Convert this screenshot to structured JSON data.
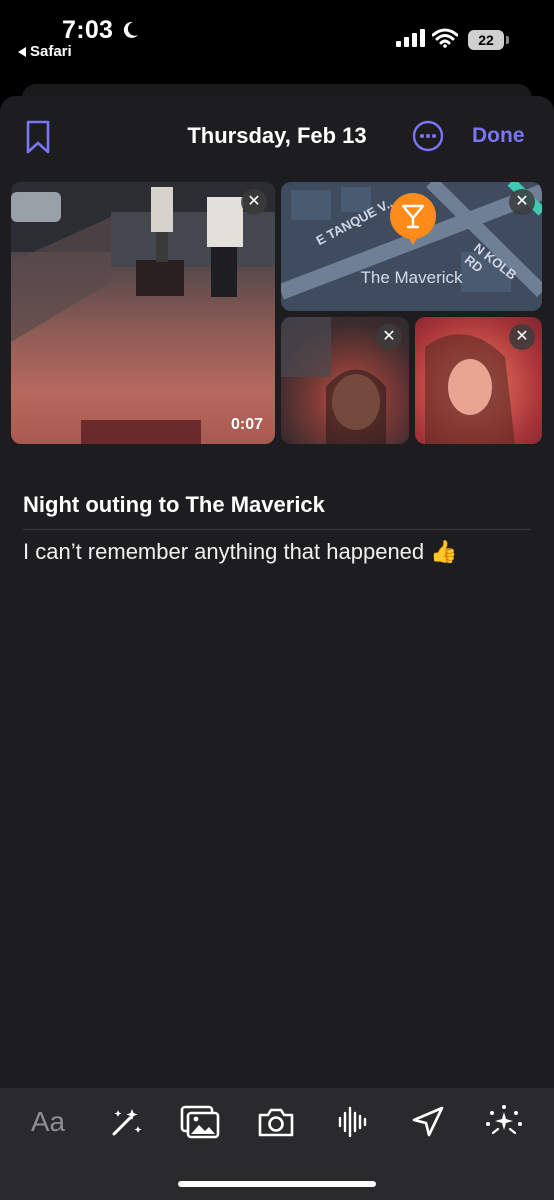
{
  "status_bar": {
    "time": "7:03",
    "back_label": "Safari",
    "battery": "22"
  },
  "header": {
    "title": "Thursday, Feb 13",
    "done_label": "Done"
  },
  "media": {
    "video_duration": "0:07",
    "map_place": "The Maverick",
    "map_street_1": "E TANQUE V...",
    "map_street_2": "N KOLB RD",
    "close_glyph": "✕"
  },
  "entry": {
    "title": "Night outing to The Maverick",
    "body": "I can’t remember anything that happened 👍"
  },
  "toolbar": {
    "text_style_label": "Aa",
    "icons": [
      "text-style-icon",
      "magic-wand-icon",
      "photo-library-icon",
      "camera-icon",
      "audio-icon",
      "location-icon",
      "more-sparkle-icon"
    ]
  },
  "colors": {
    "accent": "#7b74f5",
    "sheet_bg": "#1d1d1f",
    "toolbar_bg": "#2a2a2c",
    "pin_orange": "#ff8c1a"
  }
}
